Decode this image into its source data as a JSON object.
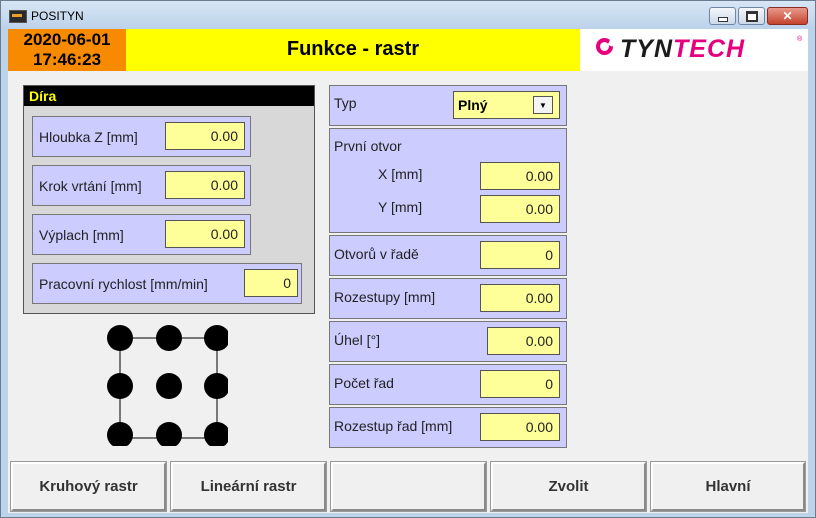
{
  "window": {
    "title": "POSITYN"
  },
  "header": {
    "date": "2020-06-01",
    "time": "17:46:23",
    "title": "Funkce - rastr",
    "logo": "TYNTECH"
  },
  "dira": {
    "title": "Díra",
    "fields": [
      {
        "label": "Hloubka Z [mm]",
        "value": "0.00"
      },
      {
        "label": "Krok vrtání [mm]",
        "value": "0.00"
      },
      {
        "label": "Výplach [mm]",
        "value": "0.00"
      },
      {
        "label": "Pracovní rychlost [mm/min]",
        "value": "0"
      }
    ]
  },
  "params": {
    "typ": {
      "label": "Typ",
      "value": "Plný"
    },
    "prvni_otvor": {
      "label": "První otvor",
      "x_label": "X [mm]",
      "x_value": "0.00",
      "y_label": "Y [mm]",
      "y_value": "0.00"
    },
    "fields": [
      {
        "label": "Otvorů v řadě",
        "value": "0"
      },
      {
        "label": "Rozestupy [mm]",
        "value": "0.00"
      },
      {
        "label": "Úhel [°]",
        "value": "0.00"
      },
      {
        "label": "Počet řad",
        "value": "0"
      },
      {
        "label": "Rozestup řad [mm]",
        "value": "0.00"
      }
    ]
  },
  "buttons": [
    "Kruhový rastr",
    "Lineární rastr",
    "",
    "Zvolit",
    "Hlavní"
  ]
}
